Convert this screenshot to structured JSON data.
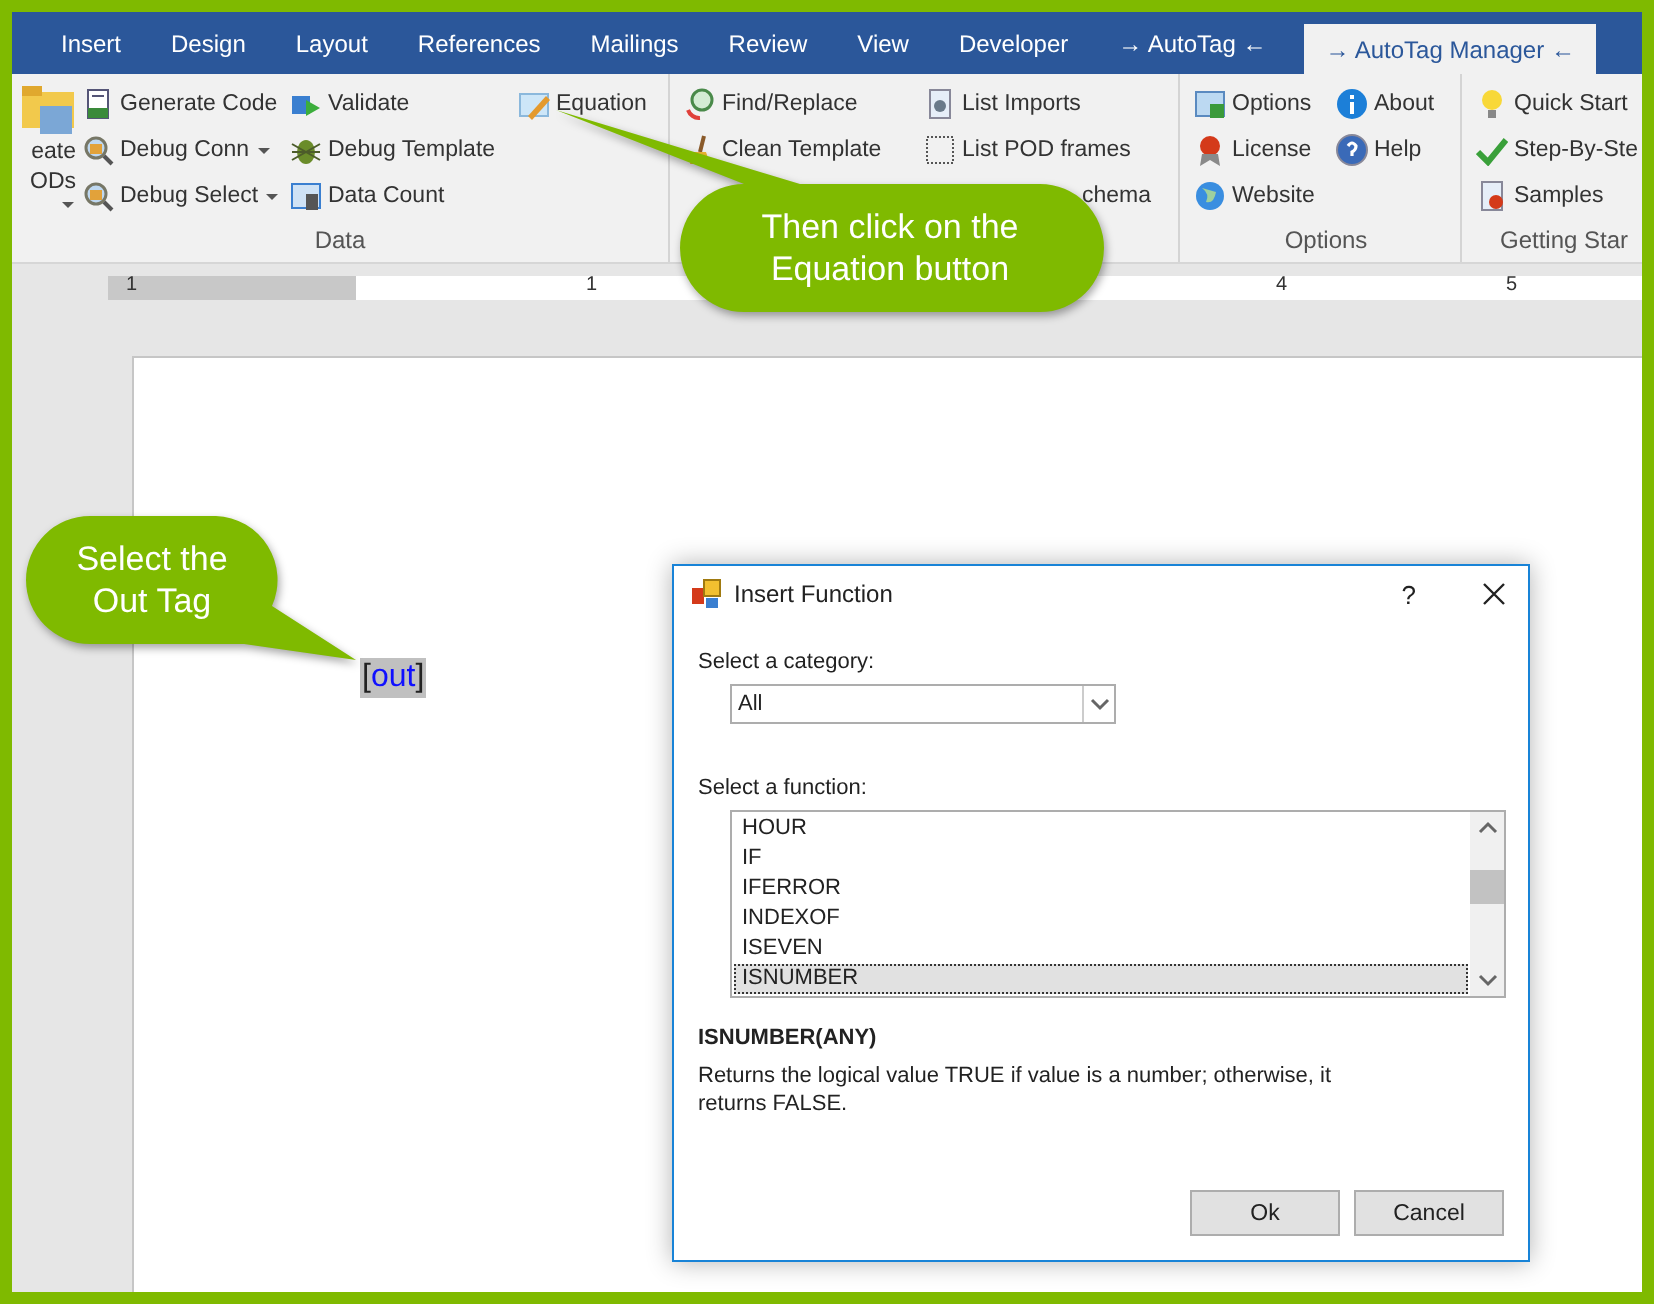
{
  "tabs": [
    {
      "label": "Insert",
      "selected": false
    },
    {
      "label": "Design",
      "selected": false
    },
    {
      "label": "Layout",
      "selected": false
    },
    {
      "label": "References",
      "selected": false
    },
    {
      "label": "Mailings",
      "selected": false
    },
    {
      "label": "Review",
      "selected": false
    },
    {
      "label": "View",
      "selected": false
    },
    {
      "label": "Developer",
      "selected": false
    },
    {
      "label": "→ AutoTag ←",
      "selected": false
    },
    {
      "label": "→ AutoTag Manager ←",
      "selected": true
    }
  ],
  "ribbon_groups": [
    {
      "label": "Data",
      "columns": [
        [
          {
            "kind": "large",
            "lines": [
              "eate",
              "ODs"
            ],
            "dropdown": true
          }
        ],
        [
          {
            "kind": "small",
            "label": "Generate Code",
            "dropdown": false
          },
          {
            "kind": "small",
            "label": "Debug Conn",
            "dropdown": true
          },
          {
            "kind": "small",
            "label": "Debug Select",
            "dropdown": true
          }
        ],
        [
          {
            "kind": "small",
            "label": "Validate",
            "dropdown": false
          },
          {
            "kind": "small",
            "label": "Debug Template",
            "dropdown": false
          },
          {
            "kind": "small",
            "label": "Data Count",
            "dropdown": false
          }
        ],
        [
          {
            "kind": "small",
            "label": "Equation",
            "dropdown": false
          }
        ]
      ]
    },
    {
      "columns": [
        [
          {
            "kind": "small",
            "label": "Find/Replace",
            "dropdown": false
          },
          {
            "kind": "small",
            "label": "Clean Template",
            "dropdown": false
          }
        ],
        [
          {
            "kind": "small",
            "label": "List Imports",
            "dropdown": false
          },
          {
            "kind": "small",
            "label": "List POD frames",
            "dropdown": false
          },
          {
            "kind": "small",
            "label": "chema",
            "dropdown": false
          }
        ]
      ]
    },
    {
      "label": "Options",
      "columns": [
        [
          {
            "kind": "small",
            "label": "Options",
            "dropdown": false
          },
          {
            "kind": "small",
            "label": "License",
            "dropdown": false
          },
          {
            "kind": "small",
            "label": "Website",
            "dropdown": false
          }
        ],
        [
          {
            "kind": "small",
            "label": "About",
            "dropdown": false
          },
          {
            "kind": "small",
            "label": "Help",
            "dropdown": false
          }
        ]
      ]
    },
    {
      "label": "Getting Star",
      "columns": [
        [
          {
            "kind": "small",
            "label": "Quick Start",
            "dropdown": false
          },
          {
            "kind": "small",
            "label": "Step-By-Ste",
            "dropdown": false
          },
          {
            "kind": "small",
            "label": "Samples",
            "dropdown": false
          }
        ]
      ]
    }
  ],
  "ruler_labels": [
    "1",
    "1",
    "4",
    "5"
  ],
  "document": {
    "bracket_open": "[",
    "tag": "out",
    "bracket_close": "]"
  },
  "dialog": {
    "title": "Insert Function",
    "help": "?",
    "category_label": "Select a category:",
    "category": "All",
    "function_label": "Select a function:",
    "functions": [
      {
        "label": "HOUR",
        "selected": false
      },
      {
        "label": "IF",
        "selected": false
      },
      {
        "label": "IFERROR",
        "selected": false
      },
      {
        "label": "INDEXOF",
        "selected": false
      },
      {
        "label": "ISEVEN",
        "selected": false
      },
      {
        "label": "ISNUMBER",
        "selected": true
      }
    ],
    "signature": "ISNUMBER(ANY)",
    "description": "Returns the logical value TRUE if value is a number; otherwise, it returns FALSE.",
    "buttons": [
      "Ok",
      "Cancel"
    ]
  },
  "callouts": [
    {
      "text": "Then click on the\nEquation button"
    },
    {
      "text": "Select the\nOut Tag"
    }
  ]
}
